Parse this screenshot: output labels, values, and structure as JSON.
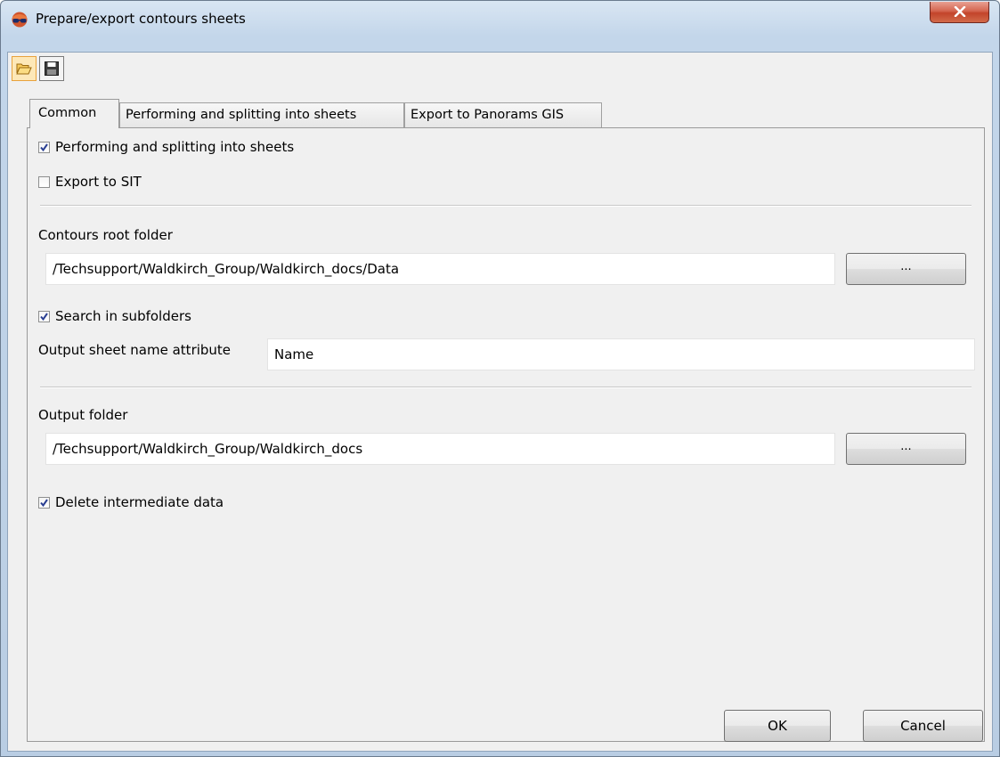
{
  "window": {
    "title": "Prepare/export contours sheets"
  },
  "toolbar": {
    "open_icon": "folder-open-icon",
    "save_icon": "floppy-save-icon"
  },
  "tabs": [
    {
      "label": "Common",
      "active": true
    },
    {
      "label": "Performing and splitting into sheets",
      "active": false
    },
    {
      "label": "Export to Panorams GIS",
      "active": false
    }
  ],
  "common": {
    "performing_label": "Performing and splitting into sheets",
    "performing_checked": true,
    "export_sit_label": "Export to SIT",
    "export_sit_checked": false,
    "contours_root_label": "Contours root folder",
    "contours_root_value": "/Techsupport/Waldkirch_Group/Waldkirch_docs/Data",
    "browse_label": "...",
    "search_subfolders_label": "Search in subfolders",
    "search_subfolders_checked": true,
    "sheet_name_attr_label": "Output sheet name attribute",
    "sheet_name_attr_value": "Name",
    "output_folder_label": "Output folder",
    "output_folder_value": "/Techsupport/Waldkirch_Group/Waldkirch_docs",
    "delete_intermediate_label": "Delete intermediate data",
    "delete_intermediate_checked": true
  },
  "buttons": {
    "ok": "OK",
    "cancel": "Cancel"
  }
}
